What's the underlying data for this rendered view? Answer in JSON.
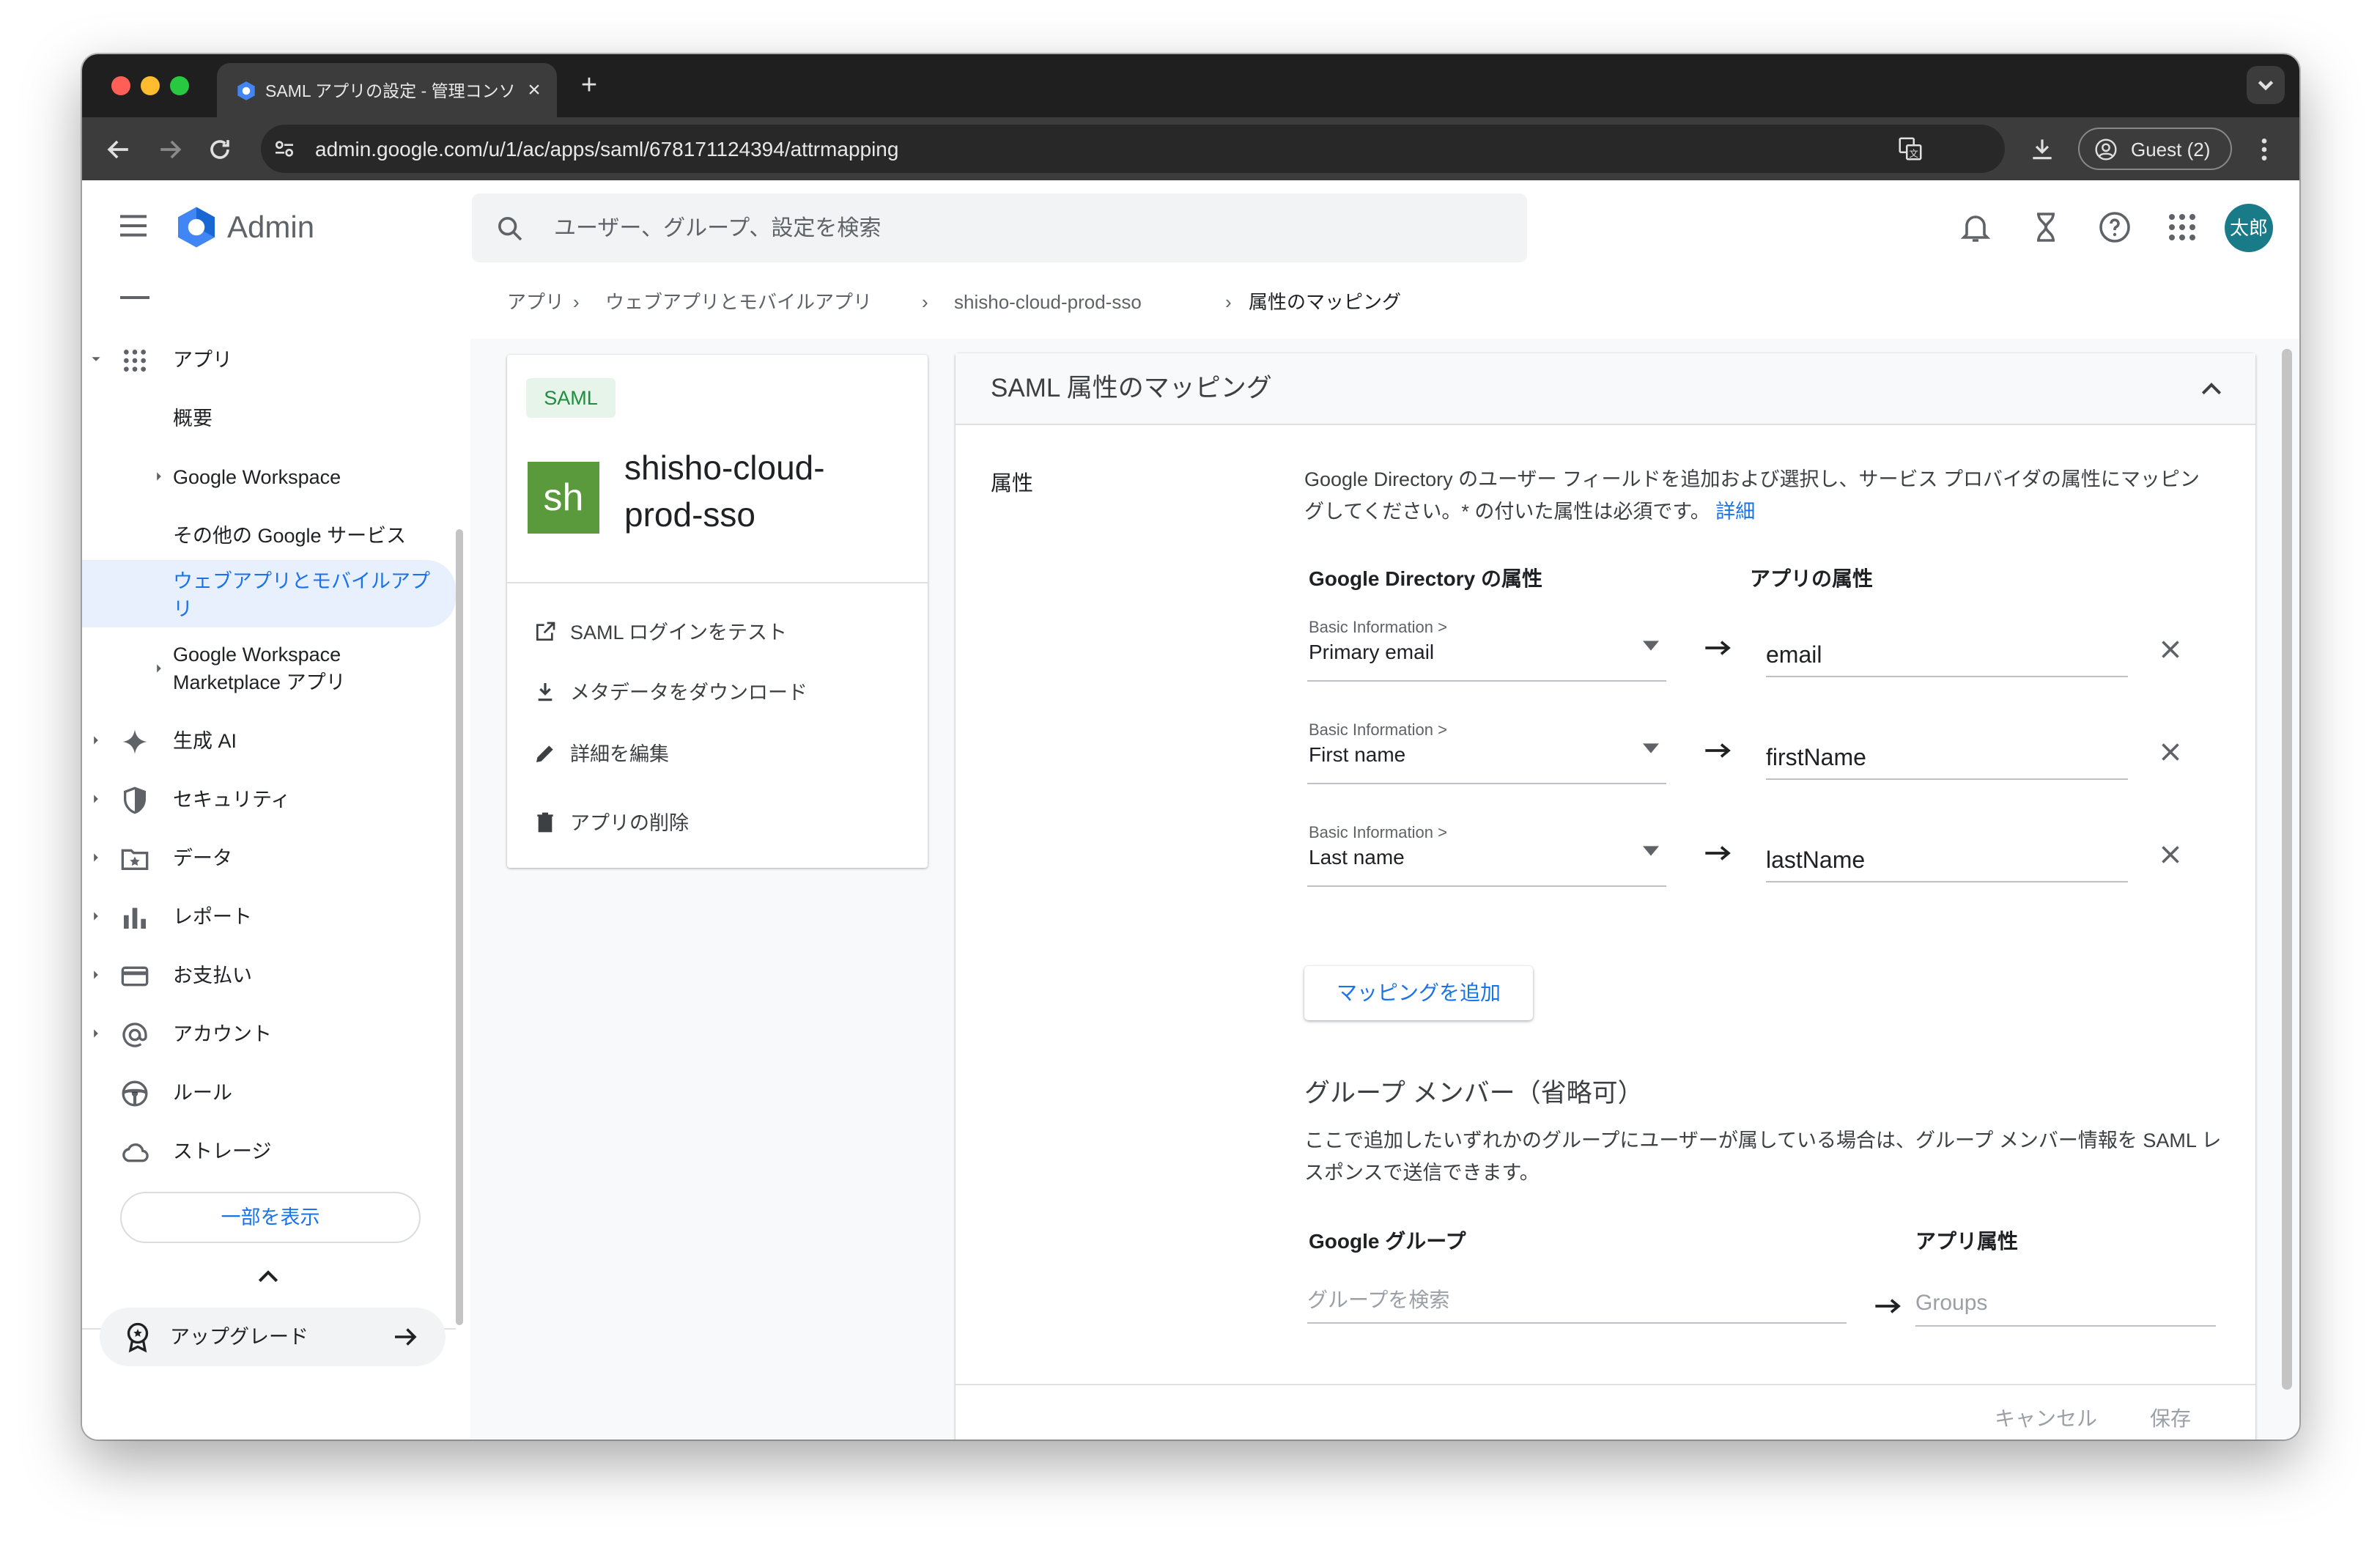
{
  "browser": {
    "tab_title": "SAML アプリの設定 - 管理コンソール",
    "url": "admin.google.com/u/1/ac/apps/saml/678171124394/attrmapping",
    "profile_label": "Guest (2)"
  },
  "topbar": {
    "product": "Admin",
    "search_placeholder": "ユーザー、グループ、設定を検索",
    "avatar_text": "太郎"
  },
  "sidebar": {
    "items": [
      {
        "label": "アプリ",
        "icon": "apps-grid-icon"
      },
      {
        "label": "概要"
      },
      {
        "label": "Google Workspace"
      },
      {
        "label": "その他の Google サービス"
      },
      {
        "label": "ウェブアプリとモバイルアプリ"
      },
      {
        "label": "Google Workspace Marketplace アプリ"
      },
      {
        "label": "生成 AI",
        "icon": "sparkle-icon"
      },
      {
        "label": "セキュリティ",
        "icon": "shield-icon"
      },
      {
        "label": "データ",
        "icon": "folder-star-icon"
      },
      {
        "label": "レポート",
        "icon": "bar-chart-icon"
      },
      {
        "label": "お支払い",
        "icon": "credit-card-icon"
      },
      {
        "label": "アカウント",
        "icon": "at-sign-icon"
      },
      {
        "label": "ルール",
        "icon": "steering-wheel-icon"
      },
      {
        "label": "ストレージ",
        "icon": "cloud-icon"
      }
    ],
    "show_less": "一部を表示",
    "upgrade": "アップグレード"
  },
  "breadcrumb": [
    "アプリ",
    "ウェブアプリとモバイルアプリ",
    "shisho-cloud-prod-sso",
    "属性のマッピング"
  ],
  "app_card": {
    "badge": "SAML",
    "icon_text": "sh",
    "name": "shisho-cloud-prod-sso",
    "actions": [
      {
        "label": "SAML ログインをテスト",
        "icon": "open-in-new-icon"
      },
      {
        "label": "メタデータをダウンロード",
        "icon": "download-icon"
      },
      {
        "label": "詳細を編集",
        "icon": "pencil-icon"
      },
      {
        "label": "アプリの削除",
        "icon": "trash-icon"
      }
    ]
  },
  "mapping": {
    "title": "SAML 属性のマッピング",
    "section_label": "属性",
    "description": "Google Directory のユーザー フィールドを追加および選択し、サービス プロバイダの属性にマッピングしてください。* の付いた属性は必須です。",
    "details_link": "詳細",
    "col_directory": "Google Directory の属性",
    "col_app": "アプリの属性",
    "rows": [
      {
        "category": "Basic Information >",
        "field": "Primary email",
        "app_attr": "email"
      },
      {
        "category": "Basic Information >",
        "field": "First name",
        "app_attr": "firstName"
      },
      {
        "category": "Basic Information >",
        "field": "Last name",
        "app_attr": "lastName"
      }
    ],
    "add_mapping": "マッピングを追加",
    "group_title": "グループ メンバー（省略可）",
    "group_desc": "ここで追加したいずれかのグループにユーザーが属している場合は、グループ メンバー情報を SAML レスポンスで送信できます。",
    "col_google_group": "Google グループ",
    "col_app_attr": "アプリ属性",
    "group_search_placeholder": "グループを検索",
    "groups_placeholder": "Groups",
    "cancel": "キャンセル",
    "save": "保存"
  }
}
